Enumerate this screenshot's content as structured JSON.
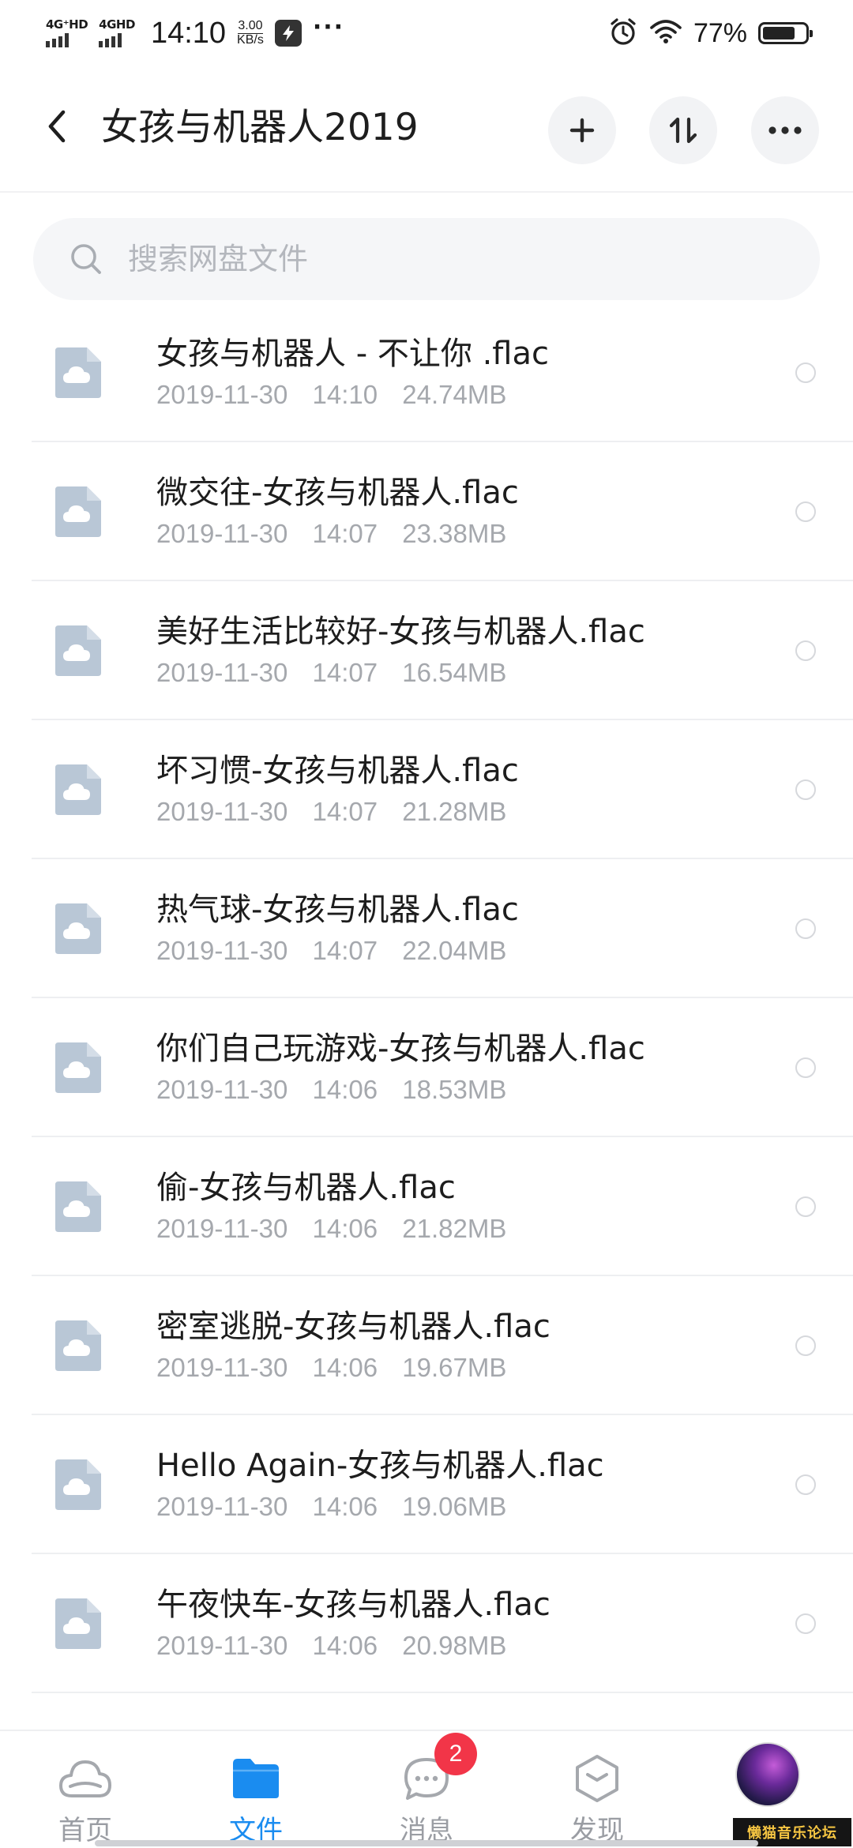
{
  "status_bar": {
    "sim1_label": "4G⁺HD",
    "sim2_label": "4GHD",
    "time": "14:10",
    "net_speed_value": "3.00",
    "net_speed_unit": "KB/s",
    "more_dots": "···",
    "battery_percent": "77%",
    "battery_level": 0.77
  },
  "header": {
    "title": "女孩与机器人2019"
  },
  "search": {
    "placeholder": "搜索网盘文件"
  },
  "files": [
    {
      "name": "女孩与机器人 - 不让你 .flac",
      "date": "2019-11-30",
      "time": "14:10",
      "size": "24.74MB"
    },
    {
      "name": "微交往-女孩与机器人.flac",
      "date": "2019-11-30",
      "time": "14:07",
      "size": "23.38MB"
    },
    {
      "name": "美好生活比较好-女孩与机器人.flac",
      "date": "2019-11-30",
      "time": "14:07",
      "size": "16.54MB"
    },
    {
      "name": "坏习惯-女孩与机器人.flac",
      "date": "2019-11-30",
      "time": "14:07",
      "size": "21.28MB"
    },
    {
      "name": "热气球-女孩与机器人.flac",
      "date": "2019-11-30",
      "time": "14:07",
      "size": "22.04MB"
    },
    {
      "name": "你们自己玩游戏-女孩与机器人.flac",
      "date": "2019-11-30",
      "time": "14:06",
      "size": "18.53MB"
    },
    {
      "name": "偷-女孩与机器人.flac",
      "date": "2019-11-30",
      "time": "14:06",
      "size": "21.82MB"
    },
    {
      "name": "密室逃脱-女孩与机器人.flac",
      "date": "2019-11-30",
      "time": "14:06",
      "size": "19.67MB"
    },
    {
      "name": "Hello Again-女孩与机器人.flac",
      "date": "2019-11-30",
      "time": "14:06",
      "size": "19.06MB"
    },
    {
      "name": "午夜快车-女孩与机器人.flac",
      "date": "2019-11-30",
      "time": "14:06",
      "size": "20.98MB"
    }
  ],
  "bottom_nav": {
    "home": "首页",
    "files": "文件",
    "messages": "消息",
    "messages_badge": "2",
    "discover": "发现"
  },
  "watermark": "懒猫音乐论坛",
  "colors": {
    "accent": "#1a8cf0",
    "badge": "#f23548",
    "file_icon": "#b9c7d6"
  },
  "icons": {
    "back": "chevron-left-icon",
    "add": "plus-icon",
    "sort": "sort-arrows-icon",
    "more": "more-dots-icon",
    "search": "search-icon",
    "file": "cloud-file-icon",
    "nav_home": "cloud-icon",
    "nav_files": "folder-icon",
    "nav_messages": "chat-bubble-icon",
    "nav_discover": "cube-icon"
  }
}
